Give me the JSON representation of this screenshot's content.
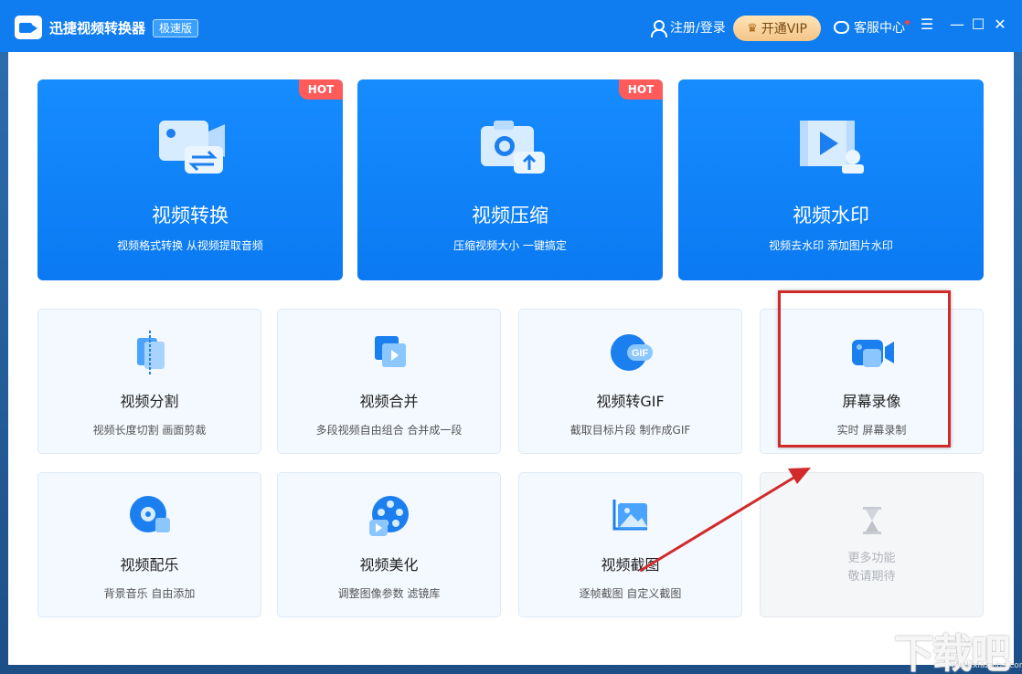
{
  "app": {
    "title": "迅捷视频转换器",
    "edition": "极速版"
  },
  "titlebar": {
    "login": "注册/登录",
    "vip": "开通VIP",
    "support": "客服中心"
  },
  "big_cards": [
    {
      "title": "视频转换",
      "desc": "视频格式转换 从视频提取音频",
      "badge": "HOT",
      "icon": "video-convert-icon"
    },
    {
      "title": "视频压缩",
      "desc": "压缩视频大小 一键搞定",
      "badge": "HOT",
      "icon": "video-compress-icon"
    },
    {
      "title": "视频水印",
      "desc": "视频去水印 添加图片水印",
      "icon": "video-watermark-icon"
    }
  ],
  "small_cards": [
    {
      "title": "视频分割",
      "desc": "视频长度切割 画面剪裁",
      "icon": "video-split-icon"
    },
    {
      "title": "视频合并",
      "desc": "多段视频自由组合 合并成一段",
      "icon": "video-merge-icon"
    },
    {
      "title": "视频转GIF",
      "desc": "截取目标片段 制作成GIF",
      "icon": "gif-icon"
    },
    {
      "title": "屏幕录像",
      "desc": "实时 屏幕录制",
      "icon": "screen-record-icon"
    },
    {
      "title": "视频配乐",
      "desc": "背景音乐 自由添加",
      "icon": "music-icon"
    },
    {
      "title": "视频美化",
      "desc": "调整图像参数 滤镜库",
      "icon": "film-reel-icon"
    },
    {
      "title": "视频截图",
      "desc": "逐帧截图 自定义截图",
      "icon": "screenshot-icon"
    },
    {
      "title": "",
      "desc": "更多功能\n敬请期待",
      "icon": "hourglass-icon"
    }
  ],
  "watermark": {
    "text": "下载吧",
    "url": "www.xiazaiba.com"
  },
  "colors": {
    "accent": "#0f7df0",
    "highlight": "#d12a2a"
  }
}
